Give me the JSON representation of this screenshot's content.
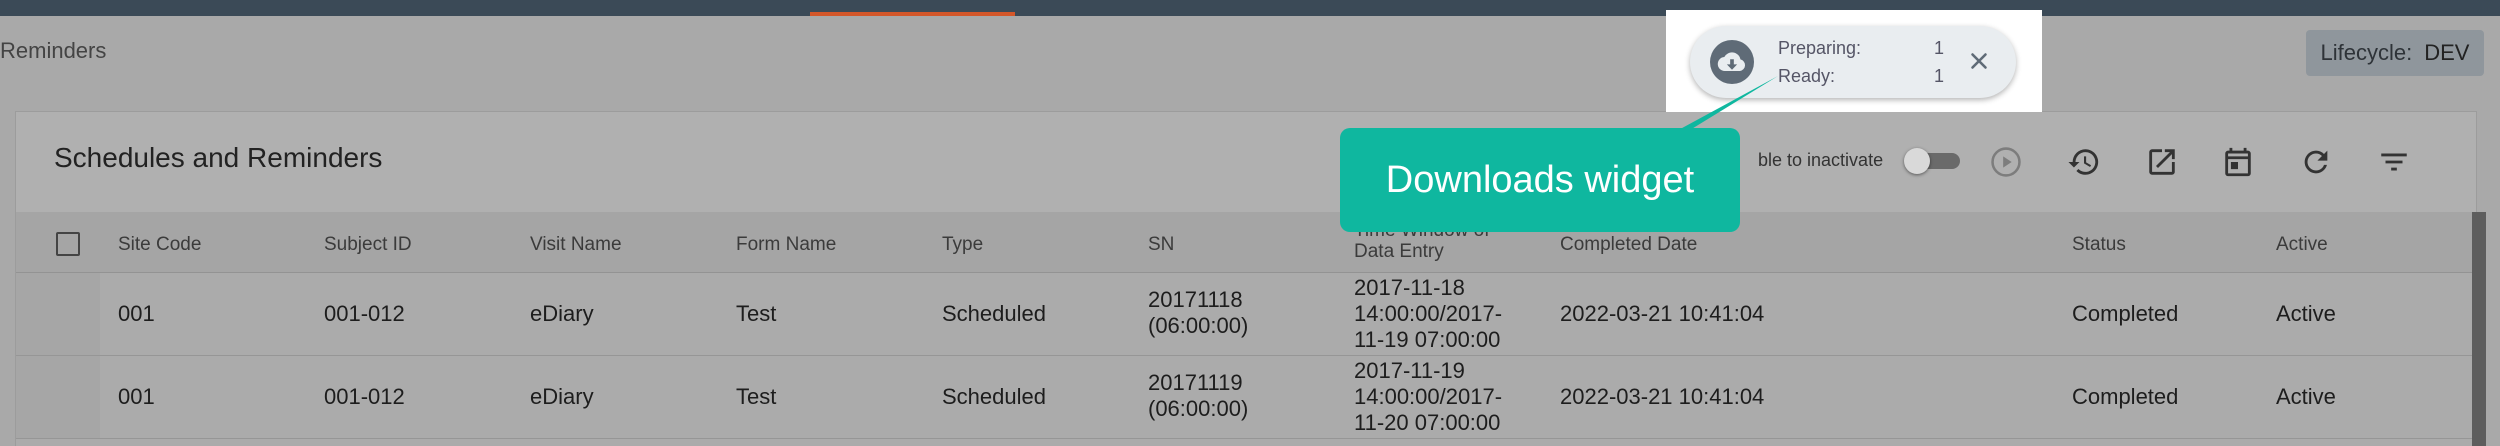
{
  "breadcrumb": "Reminders",
  "lifecycle": {
    "label": "Lifecycle:",
    "value": "DEV"
  },
  "panel": {
    "title": "Schedules and Reminders",
    "toggle_label": "ble to inactivate"
  },
  "toolbar_icons": [
    "play-icon",
    "history-icon",
    "open-external-icon",
    "calendar-icon",
    "refresh-icon",
    "filter-icon"
  ],
  "columns": [
    "Site Code",
    "Subject ID",
    "Visit Name",
    "Form Name",
    "Type",
    "SN",
    "Time Window of",
    "Data Entry",
    "Completed Date",
    "Status",
    "Active"
  ],
  "rows": [
    {
      "site": "001",
      "subject": "001-012",
      "visit": "eDiary",
      "form": "Test",
      "type": "Scheduled",
      "sn1": "20171118",
      "sn2": "(06:00:00)",
      "tw1": "2017-11-18",
      "tw2": "14:00:00/2017-",
      "tw3": "11-19 07:00:00",
      "completed": "2022-03-21 10:41:04",
      "status": "Completed",
      "active": "Active"
    },
    {
      "site": "001",
      "subject": "001-012",
      "visit": "eDiary",
      "form": "Test",
      "type": "Scheduled",
      "sn1": "20171119",
      "sn2": "(06:00:00)",
      "tw1": "2017-11-19",
      "tw2": "14:00:00/2017-",
      "tw3": "11-20 07:00:00",
      "completed": "2022-03-21 10:41:04",
      "status": "Completed",
      "active": "Active"
    }
  ],
  "downloads": {
    "preparing_label": "Preparing:",
    "preparing_count": "1",
    "ready_label": "Ready:",
    "ready_count": "1"
  },
  "callout": "Downloads widget",
  "colors": {
    "callout": "#0fb79f",
    "topbar": "#3b4a57",
    "accent": "#d4572a"
  }
}
